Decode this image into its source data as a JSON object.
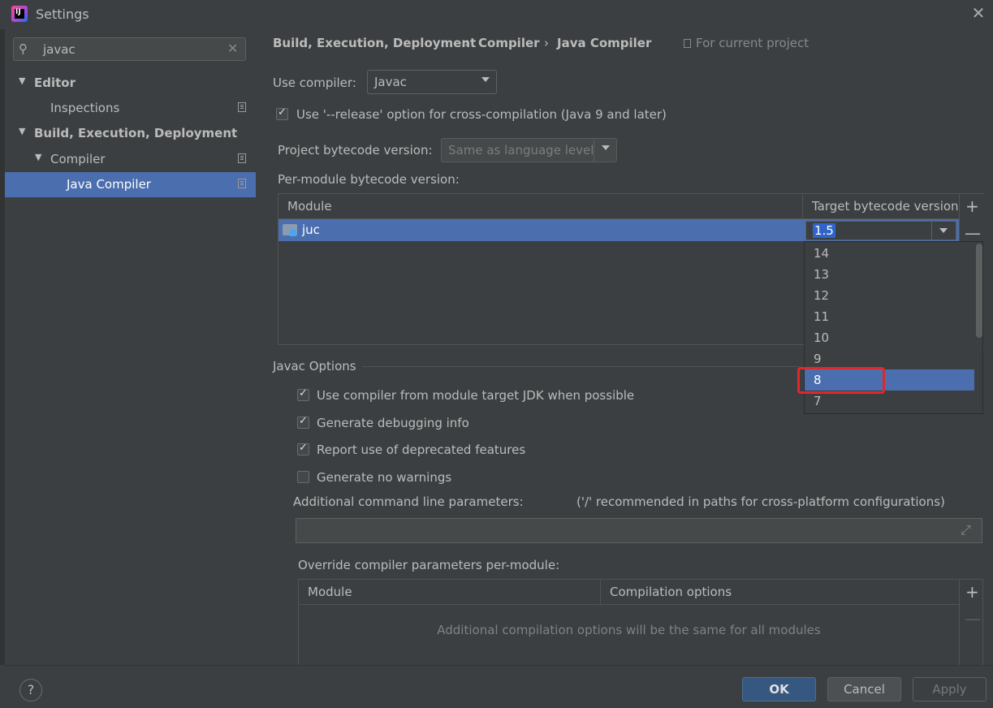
{
  "window": {
    "title": "Settings"
  },
  "search": {
    "value": "javac"
  },
  "tree": {
    "editor": "Editor",
    "inspections": "Inspections",
    "build": "Build, Execution, Deployment",
    "compiler": "Compiler",
    "java_compiler": "Java Compiler"
  },
  "breadcrumb": {
    "part1": "Build, Execution, Deployment",
    "part2": "Compiler",
    "part3": "Java Compiler",
    "sep": "›",
    "for_current_project": "For current project"
  },
  "use_compiler": {
    "label": "Use compiler:",
    "value": "Javac"
  },
  "release_option": {
    "label": "Use '--release' option for cross-compilation (Java 9 and later)",
    "checked": true
  },
  "project_bytecode": {
    "label": "Project bytecode version:",
    "value": "Same as language level"
  },
  "per_module": {
    "label": "Per-module bytecode version:",
    "columns": [
      "Module",
      "Target bytecode version"
    ],
    "rows": [
      {
        "module": "juc",
        "version": "1.5"
      }
    ]
  },
  "version_dropdown": {
    "options": [
      "14",
      "13",
      "12",
      "11",
      "10",
      "9",
      "8",
      "7"
    ],
    "selected": "8"
  },
  "javac_options": {
    "title": "Javac Options",
    "opt1": "Use compiler from module target JDK when possible",
    "opt2": "Generate debugging info",
    "opt3": "Report use of deprecated features",
    "opt4": "Generate no warnings",
    "additional_label": "Additional command line parameters:",
    "additional_hint": "('/' recommended in paths for cross-platform configurations)",
    "additional_value": ""
  },
  "override": {
    "label": "Override compiler parameters per-module:",
    "columns": [
      "Module",
      "Compilation options"
    ],
    "empty_text": "Additional compilation options will be the same for all modules"
  },
  "footer": {
    "help": "?",
    "ok": "OK",
    "cancel": "Cancel",
    "apply": "Apply"
  },
  "icons": {
    "plus": "+",
    "minus": "—"
  }
}
